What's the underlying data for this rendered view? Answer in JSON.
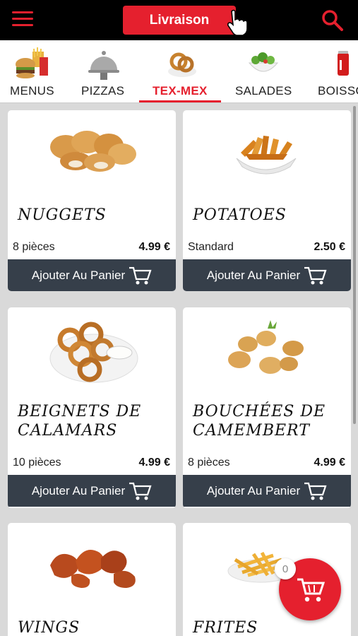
{
  "header": {
    "menu_icon": "hamburger-menu-icon",
    "delivery_button_label": "Livraison",
    "search_icon": "search-icon",
    "accent_color": "#e5202e"
  },
  "categories": [
    {
      "label": "MENUS",
      "icon": "burger-fries-icon",
      "active": false
    },
    {
      "label": "PIZZAS",
      "icon": "cloche-icon",
      "active": false
    },
    {
      "label": "TEX-MEX",
      "icon": "onion-rings-icon",
      "active": true
    },
    {
      "label": "SALADES",
      "icon": "salad-bowl-icon",
      "active": false
    },
    {
      "label": "BOISSO",
      "icon": "soda-can-icon",
      "active": false
    }
  ],
  "products": [
    {
      "name": "NUGGETS",
      "desc": "8 pièces",
      "price": "4.99 €",
      "button": "Ajouter Au Panier"
    },
    {
      "name": "POTATOES",
      "desc": "Standard",
      "price": "2.50 €",
      "button": "Ajouter Au Panier"
    },
    {
      "name_line1": "BEIGNETS DE",
      "name_line2": "CALAMARS",
      "desc": "10 pièces",
      "price": "4.99 €",
      "button": "Ajouter Au Panier"
    },
    {
      "name_line1": "BOUCHÉES DE",
      "name_line2": "CAMEMBERT",
      "desc": "8 pièces",
      "price": "4.99 €",
      "button": "Ajouter Au Panier"
    },
    {
      "name": "WINGS"
    },
    {
      "name": "FRITES"
    }
  ],
  "cart": {
    "count": "0",
    "icon": "cart-icon"
  }
}
